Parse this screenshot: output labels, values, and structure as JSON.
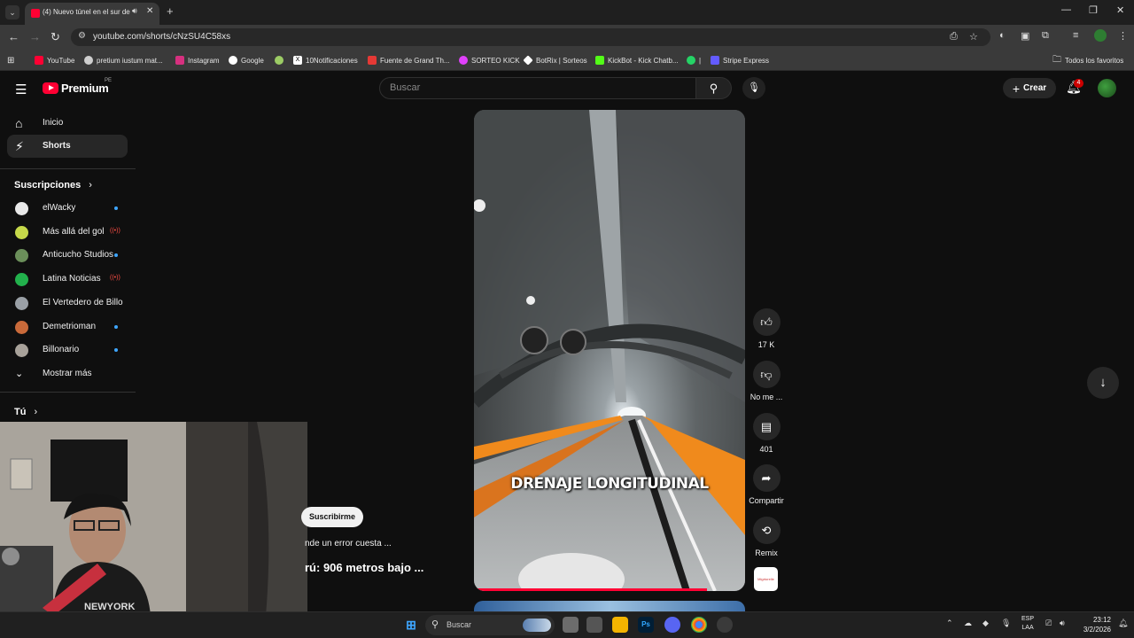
{
  "browser": {
    "tab_title": "(4) Nuevo túnel en el sur de",
    "url": "youtube.com/shorts/cNzSU4C58xs",
    "bookmarks": [
      {
        "label": "YouTube",
        "color": "#ff0033"
      },
      {
        "label": "pretium iustum mat...",
        "color": "#cfcfcf"
      },
      {
        "label": "Instagram",
        "color": "#d6307f"
      },
      {
        "label": "Google",
        "color": "#ffffff"
      },
      {
        "label": "",
        "color": "#9ccc65"
      },
      {
        "label": "10Notificaciones",
        "color": "#ffffff"
      },
      {
        "label": "Fuente de Grand Th...",
        "color": "#e53935"
      },
      {
        "label": "SORTEO KICK",
        "color": "#e040fb"
      },
      {
        "label": "BotRix | Sorteos",
        "color": "#ffffff"
      },
      {
        "label": "KickBot - Kick Chatb...",
        "color": "#53fc18"
      },
      {
        "label": "|",
        "color": "#25d366"
      },
      {
        "label": "Stripe Express",
        "color": "#635bff"
      }
    ],
    "all_favorites": "Todos los favoritos"
  },
  "youtube": {
    "logo_text": "Premium",
    "logo_country": "PE",
    "search_placeholder": "Buscar",
    "create_label": "Crear",
    "notification_count": "4"
  },
  "sidebar": {
    "home": "Inicio",
    "shorts": "Shorts",
    "subscriptions_heading": "Suscripciones",
    "subscriptions": [
      {
        "name": "elWacky",
        "indicator": "dot",
        "avatar_color": "#e8e8e8"
      },
      {
        "name": "Más allá del gol",
        "indicator": "live",
        "avatar_color": "#c6d94a"
      },
      {
        "name": "Anticucho Studios",
        "indicator": "dot",
        "avatar_color": "#6b8f5a"
      },
      {
        "name": "Latina Noticias",
        "indicator": "live",
        "avatar_color": "#22b14c"
      },
      {
        "name": "El Vertedero de Billo",
        "indicator": "none",
        "avatar_color": "#9aa0a6"
      },
      {
        "name": "Demetrioman",
        "indicator": "dot",
        "avatar_color": "#c96a3a"
      },
      {
        "name": "Billonario",
        "indicator": "dot",
        "avatar_color": "#a8a29a"
      }
    ],
    "show_more": "Mostrar más",
    "you_heading": "Tú"
  },
  "short": {
    "caption": "DRENAJE LONGITUDINAL",
    "progress": 0.86,
    "subscribe_label": "Suscribirme",
    "description": "nde un error cuesta ...",
    "title": "rú: 906 metros bajo ...",
    "actions": {
      "like_count": "17 K",
      "dislike_label": "No me ...",
      "comments_count": "401",
      "share_label": "Compartir",
      "remix_label": "Remix"
    },
    "audio_thumb_text": "Migrtorelle"
  },
  "taskbar": {
    "search_label": "Buscar",
    "apps": [
      "Ps"
    ],
    "lang_top": "ESP",
    "lang_bottom": "LAA",
    "time": "23:12",
    "date": "3/2/2026"
  }
}
